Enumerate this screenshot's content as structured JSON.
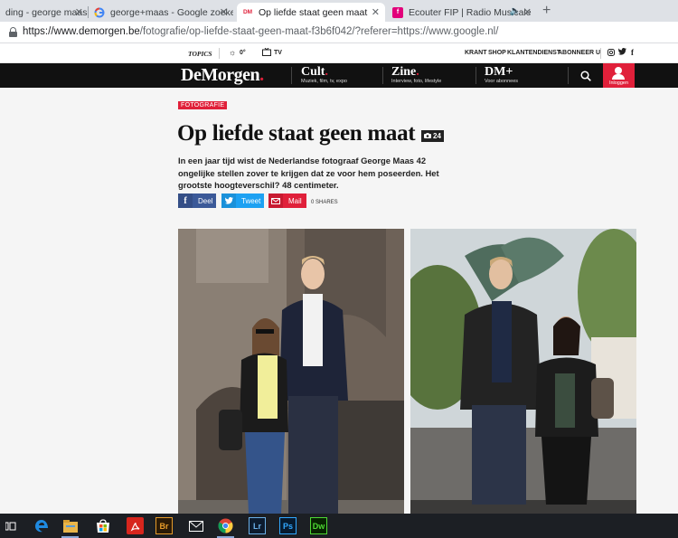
{
  "tabs": [
    {
      "title": "ding - george maas ·"
    },
    {
      "title": "george+maas - Google zoeken"
    },
    {
      "title": "Op liefde staat geen maat",
      "favicon": "DM"
    },
    {
      "title": "Ecouter FIP | Radio Musicale"
    }
  ],
  "address": {
    "host": "https://www.demorgen.be",
    "path": "/fotografie/op-liefde-staat-geen-maat-f3b6f042/?referer=https://www.google.nl/"
  },
  "topstrip": {
    "topics": "TOPICS",
    "weather": "0°",
    "tv": "TV",
    "links": [
      "KRANT",
      "SHOP",
      "KLANTENDIENST",
      "ABONNEER U"
    ]
  },
  "nav": {
    "logo": "DeMorgen",
    "logo_dot": ".",
    "items": [
      {
        "label": "Cult",
        "sub": "Muziek, film, tv, expo"
      },
      {
        "label": "Zine",
        "sub": "Interview, foto, lifestyle"
      },
      {
        "label": "DM+",
        "sub": "Voor abonnees"
      }
    ],
    "login": "Inloggen"
  },
  "article": {
    "category": "FOTOGRAFIE",
    "title": "Op liefde staat geen maat",
    "photo_count": "24",
    "lead": "In een jaar tijd wist de Nederlandse fotograaf George Maas 42 ongelijke stellen zover te krijgen dat ze voor hem poseerden. Het grootste hoogteverschil? 48 centimeter.",
    "share": {
      "facebook": "Deel",
      "twitter": "Tweet",
      "mail": "Mail",
      "shares": "0 SHARES"
    }
  },
  "colors": {
    "brand_red": "#e0203a",
    "nav_bg": "#111111",
    "facebook": "#3b5998",
    "twitter": "#1da1f2"
  },
  "taskbar": {
    "icons": [
      "task-view-icon",
      "edge-icon",
      "file-explorer-icon",
      "store-icon",
      "acrobat-icon",
      "bridge-icon",
      "mail-icon",
      "chrome-icon",
      "lightroom-icon",
      "photoshop-icon",
      "dreamweaver-icon"
    ],
    "labels": {
      "bridge": "Br",
      "lightroom": "Lr",
      "photoshop": "Ps",
      "dreamweaver": "Dw"
    }
  }
}
